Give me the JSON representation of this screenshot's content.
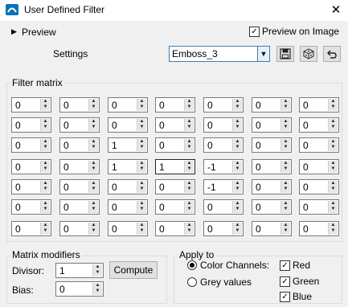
{
  "window": {
    "title": "User Defined Filter",
    "close_glyph": "✕",
    "accent_color": "#0b74b8"
  },
  "preview": {
    "label": "Preview",
    "expander_icon": "triangle-right-icon"
  },
  "preview_on_image": {
    "label": "Preview on Image",
    "checked": true
  },
  "settings": {
    "label": "Settings",
    "selected": "Emboss_3"
  },
  "toolbar_icons": [
    "save-icon",
    "random-icon",
    "undo-icon"
  ],
  "filter_matrix": {
    "label": "Filter matrix",
    "rows": [
      [
        "0",
        "0",
        "0",
        "0",
        "0",
        "0",
        "0"
      ],
      [
        "0",
        "0",
        "0",
        "0",
        "0",
        "0",
        "0"
      ],
      [
        "0",
        "0",
        "1",
        "0",
        "0",
        "0",
        "0"
      ],
      [
        "0",
        "0",
        "1",
        "1",
        "-1",
        "0",
        "0"
      ],
      [
        "0",
        "0",
        "0",
        "0",
        "-1",
        "0",
        "0"
      ],
      [
        "0",
        "0",
        "0",
        "0",
        "0",
        "0",
        "0"
      ],
      [
        "0",
        "0",
        "0",
        "0",
        "0",
        "0",
        "0"
      ]
    ]
  },
  "matrix_modifiers": {
    "label": "Matrix modifiers",
    "divisor_label": "Divisor:",
    "divisor": "1",
    "bias_label": "Bias:",
    "bias": "0",
    "compute_label": "Compute"
  },
  "apply_to": {
    "label": "Apply to",
    "color_channels_label": "Color Channels:",
    "grey_values_label": "Grey values",
    "selected": "color_channels",
    "red_label": "Red",
    "green_label": "Green",
    "blue_label": "Blue",
    "red": true,
    "green": true,
    "blue": true
  }
}
